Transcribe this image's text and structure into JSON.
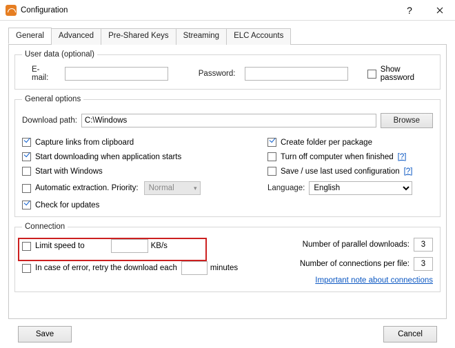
{
  "window": {
    "title": "Configuration",
    "help": "?",
    "close": "×"
  },
  "tabs": [
    "General",
    "Advanced",
    "Pre-Shared Keys",
    "Streaming",
    "ELC Accounts"
  ],
  "userdata": {
    "legend": "User data (optional)",
    "email_label": "E-mail:",
    "email_value": "",
    "password_label": "Password:",
    "password_value": "",
    "show_password": "Show password"
  },
  "general": {
    "legend": "General options",
    "download_path_label": "Download path:",
    "download_path_value": "C:\\Windows",
    "browse": "Browse",
    "left": {
      "capture": "Capture links from clipboard",
      "startdl": "Start downloading when application starts",
      "startwin": "Start with Windows",
      "autoext": "Automatic extraction. Priority:",
      "priority": "Normal",
      "updates": "Check for updates"
    },
    "right": {
      "pkgfolder": "Create folder per package",
      "turnoff": "Turn off computer when finished",
      "savecfg": "Save / use last used configuration",
      "help": "[?]",
      "lang_label": "Language:",
      "lang_value": "English"
    }
  },
  "connection": {
    "legend": "Connection",
    "limit": "Limit speed to",
    "kbs": "KB/s",
    "retry": "In case of error, retry the download each",
    "minutes": "minutes",
    "parallel_label": "Number of parallel downloads:",
    "parallel": "3",
    "perfile_label": "Number of connections per file:",
    "perfile": "3",
    "note": "Important note about connections"
  },
  "buttons": {
    "save": "Save",
    "cancel": "Cancel"
  }
}
